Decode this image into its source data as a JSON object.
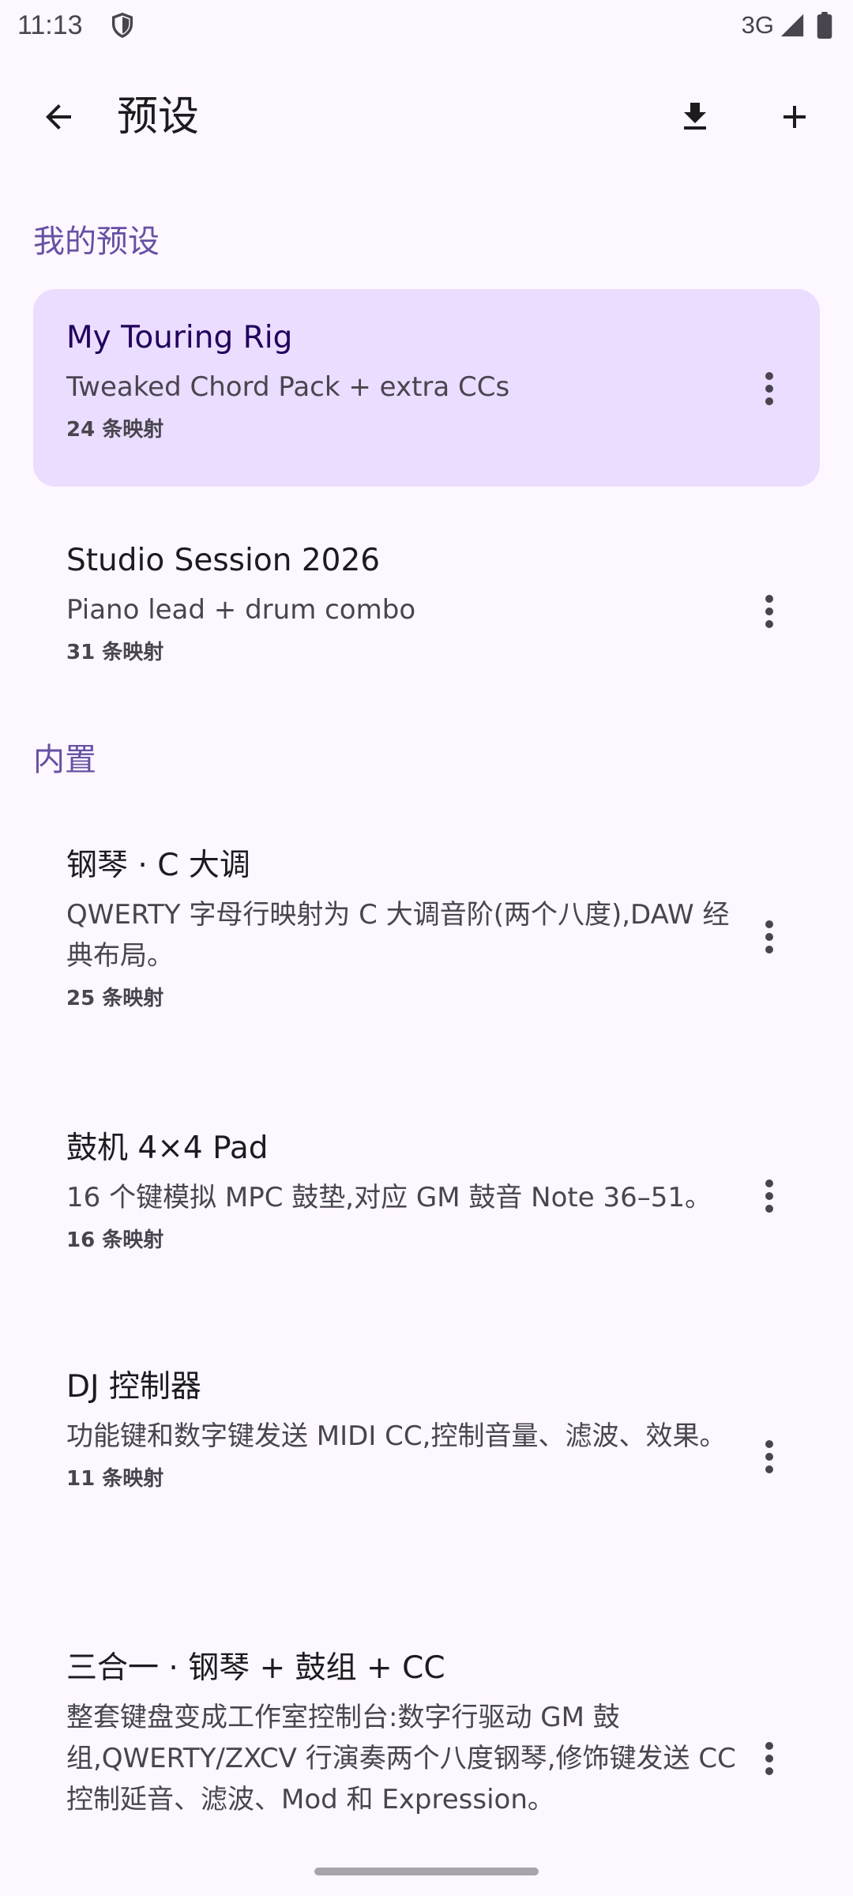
{
  "status_bar": {
    "time": "11:13",
    "network": "3G",
    "shield_icon": "shield-icon",
    "signal_icon": "signal-icon",
    "battery_icon": "battery-icon"
  },
  "app_bar": {
    "title": "预设",
    "back_icon": "arrow-back-icon",
    "download_icon": "download-icon",
    "add_icon": "add-icon"
  },
  "sections": {
    "mine": "我的预设",
    "builtin": "内置"
  },
  "my_presets": [
    {
      "title": "My Touring Rig",
      "description": "Tweaked Chord Pack + extra CCs",
      "count": "24 条映射",
      "selected": true
    },
    {
      "title": "Studio Session 2026",
      "description": "Piano lead + drum combo",
      "count": "31 条映射",
      "selected": false
    }
  ],
  "builtin_presets": [
    {
      "title": "钢琴 · C 大调",
      "description": "QWERTY 字母行映射为 C 大调音阶(两个八度),DAW 经典布局。",
      "count": "25 条映射"
    },
    {
      "title": "鼓机 4×4 Pad",
      "description": "16 个键模拟 MPC 鼓垫,对应 GM 鼓音 Note 36–51。",
      "count": "16 条映射"
    },
    {
      "title": "DJ 控制器",
      "description": "功能键和数字键发送 MIDI CC,控制音量、滤波、效果。",
      "count": "11 条映射"
    },
    {
      "title": "三合一 · 钢琴 + 鼓组 + CC",
      "description": "整套键盘变成工作室控制台:数字行驱动 GM 鼓组,QWERTY/ZXCV 行演奏两个八度钢琴,修饰键发送 CC 控制延音、滤波、Mod 和 Expression。",
      "count": ""
    }
  ],
  "colors": {
    "background": "#FDF7FF",
    "selected_background": "#EADDFF",
    "accent": "#6750A4",
    "selected_title": "#21005D"
  }
}
